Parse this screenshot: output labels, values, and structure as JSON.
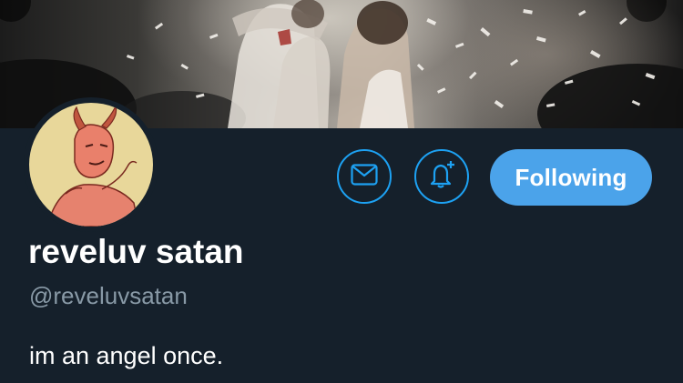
{
  "banner": {
    "image_name": "concert-confetti-banner"
  },
  "avatar": {
    "image_name": "red-devil-drawing-avatar"
  },
  "actions": {
    "message_icon": "envelope-icon",
    "notify_icon": "bell-plus-icon",
    "follow_label": "Following"
  },
  "profile": {
    "display_name": "reveluv satan",
    "handle": "@reveluvsatan",
    "bio": "im an angel once."
  },
  "colors": {
    "background": "#15202b",
    "accent": "#1da1f2",
    "follow_button": "#4ba3ea",
    "secondary_text": "#8899a6",
    "primary_text": "#ffffff"
  }
}
